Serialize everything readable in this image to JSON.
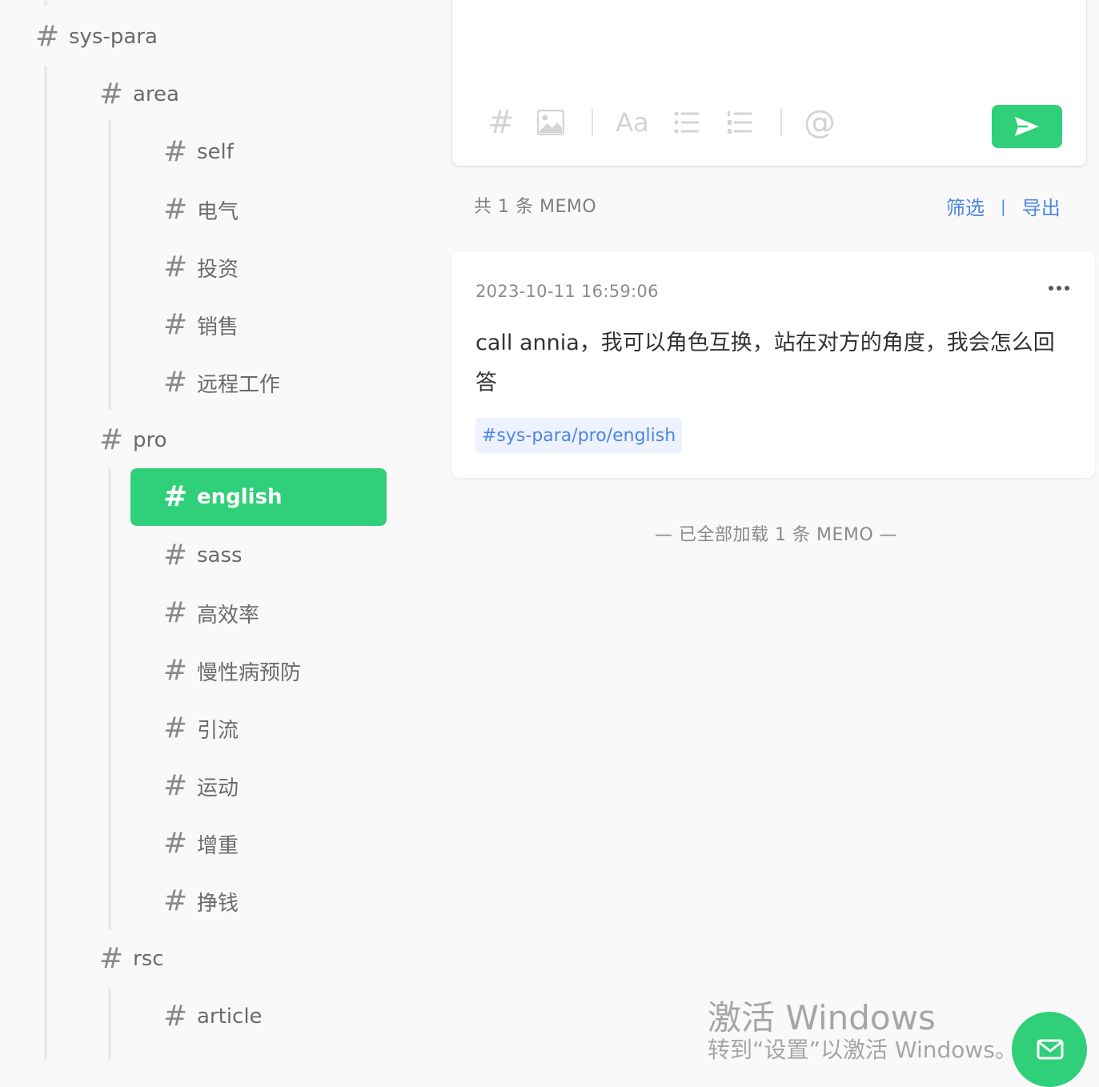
{
  "sidebar": {
    "items": [
      {
        "label": "sys-para"
      },
      {
        "label": "area"
      },
      {
        "label": "self"
      },
      {
        "label": "电气"
      },
      {
        "label": "投资"
      },
      {
        "label": "销售"
      },
      {
        "label": "远程工作"
      },
      {
        "label": "pro"
      },
      {
        "label": "english"
      },
      {
        "label": "sass"
      },
      {
        "label": "高效率"
      },
      {
        "label": "慢性病预防"
      },
      {
        "label": "引流"
      },
      {
        "label": "运动"
      },
      {
        "label": "增重"
      },
      {
        "label": "挣钱"
      },
      {
        "label": "rsc"
      },
      {
        "label": "article"
      }
    ],
    "hash": "#"
  },
  "editor": {
    "toolbar_hash": "#",
    "toolbar_text": "Aa",
    "toolbar_mention": "@"
  },
  "summary": {
    "count_text": "共 1 条 MEMO",
    "filter_label": "筛选",
    "separator": "|",
    "export_label": "导出"
  },
  "memo": {
    "timestamp": "2023-10-11 16:59:06",
    "content": "call annia，我可以角色互换，站在对方的角度，我会怎么回答",
    "tag": "#sys-para/pro/english"
  },
  "footer": {
    "loaded_text": "— 已全部加载 1 条 MEMO —"
  },
  "watermark": {
    "line1": "激活 Windows",
    "line2": "转到“设置”以激活 Windows。"
  },
  "colors": {
    "accent": "#30cf79",
    "link": "#4a86e8"
  }
}
